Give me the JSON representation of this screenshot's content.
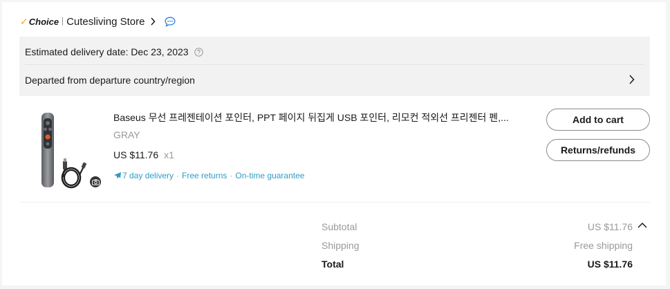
{
  "store": {
    "badge_label": "Choice",
    "name": "Cutesliving Store"
  },
  "delivery": {
    "estimated_text": "Estimated delivery date: Dec 23, 2023",
    "status_text": "Departed from departure country/region"
  },
  "item": {
    "title": "Baseus 무선 프레젠테이션 포인터, PPT 페이지 뒤집게 USB 포인터, 리모컨 적외선 프리젠터 펜,...",
    "variant": "GRAY",
    "price": "US $11.76",
    "quantity": "x1",
    "badges": {
      "delivery": "7 day delivery",
      "returns": "Free returns",
      "guarantee": "On-time guarantee"
    },
    "add_to_cart_label": "Add to cart",
    "returns_label": "Returns/refunds"
  },
  "summary": {
    "subtotal_label": "Subtotal",
    "subtotal_value": "US $11.76",
    "shipping_label": "Shipping",
    "shipping_value": "Free shipping",
    "total_label": "Total",
    "total_value": "US $11.76"
  },
  "colors": {
    "accent_link": "#2e9cc3",
    "choice_tick": "#f5a623",
    "muted_text": "#999999",
    "delivery_bg": "#f2f2f2"
  },
  "icons": {
    "chevron_right": "chevron-right-icon",
    "chat": "chat-bubble-icon",
    "help": "question-circle-icon",
    "plane": "airplane-icon",
    "camera": "camera-icon",
    "collapse": "chevron-up-icon"
  }
}
